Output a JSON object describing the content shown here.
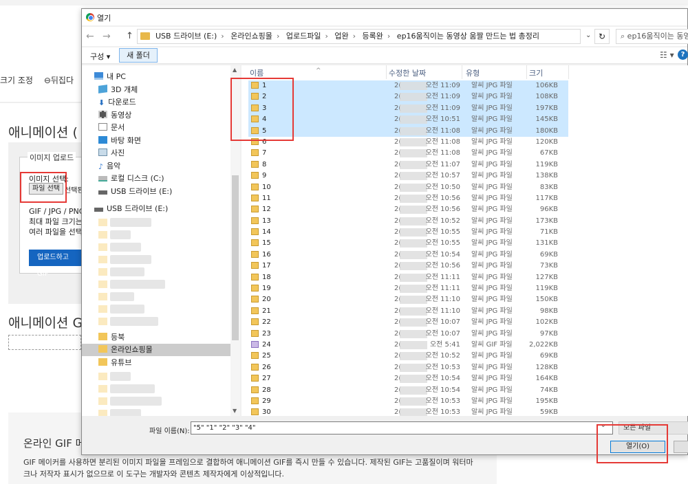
{
  "background": {
    "toolbar_items": [
      "크기 조정",
      "⊖뒤집다"
    ],
    "heading": "애니메이션 GIF",
    "heading_partial": "애니메이션 (",
    "fieldset_legend": "이미지 업로드",
    "image_select_label": "이미지 선택:",
    "file_button": "파일 선택",
    "no_file_text": "선택된",
    "notes": [
      "GIF / JPG / PNG",
      "최대 파일 크기는",
      "여러 파일을 선택"
    ],
    "upload_button": "업로드하고 GIF",
    "heading2": "애니메이션 GIF",
    "section_title": "온라인 GIF 메",
    "paragraph_line1": "GIF 메이커를 사용하면 분리된 이미지 파일을 프레임으로 결합하여 애니메이션 GIF를 즉시 만들 수 있습니다. 제작된 GIF는 고품질이며 워터마",
    "paragraph_line2": "크나 저작자 표시가 없으므로 이 도구는 개발자와 콘텐츠 제작자에게 이상적입니다."
  },
  "dialog": {
    "title": "열기",
    "nav": {
      "back": "←",
      "forward": "→",
      "up": "↑"
    },
    "breadcrumbs": [
      "USB 드라이브 (E:)",
      "온라인쇼핑몰",
      "업로드파일",
      "업완",
      "등록완",
      "ep16움직이는 동영상 움짤 만드는 법 총정리"
    ],
    "search_placeholder": "ep16움직이는 동영",
    "organize": "구성 ▾",
    "new_folder": "새 폴더",
    "sidebar": [
      {
        "label": "내 PC",
        "icon": "pc-icon"
      },
      {
        "label": "3D 개체",
        "icon": "cube-icon"
      },
      {
        "label": "다운로드",
        "icon": "download-icon"
      },
      {
        "label": "동영상",
        "icon": "video-icon"
      },
      {
        "label": "문서",
        "icon": "document-icon"
      },
      {
        "label": "바탕 화면",
        "icon": "desktop-icon"
      },
      {
        "label": "사진",
        "icon": "picture-icon"
      },
      {
        "label": "음악",
        "icon": "music-icon"
      },
      {
        "label": "로컬 디스크 (C:)",
        "icon": "drive-icon"
      },
      {
        "label": "USB 드라이브 (E:)",
        "icon": "usb-icon"
      },
      {
        "label": "USB 드라이브 (E:)",
        "icon": "usb-icon"
      }
    ],
    "sidebar_lower": {
      "folder_1": "온라인쇼핑몰",
      "folder_2": "유튜브",
      "folder_partial": "등북"
    },
    "columns": {
      "name": "이름",
      "date": "수정한 날짜",
      "type": "유형",
      "size": "크기"
    },
    "files": [
      {
        "name": "1",
        "time": "오전 11:09",
        "type": "알씨 JPG 파일",
        "size": "106KB",
        "selected": true
      },
      {
        "name": "2",
        "time": "오전 11:09",
        "type": "알씨 JPG 파일",
        "size": "108KB",
        "selected": true
      },
      {
        "name": "3",
        "time": "오전 11:09",
        "type": "알씨 JPG 파일",
        "size": "197KB",
        "selected": true
      },
      {
        "name": "4",
        "time": "오전 10:51",
        "type": "알씨 JPG 파일",
        "size": "145KB",
        "selected": true
      },
      {
        "name": "5",
        "time": "오전 11:08",
        "type": "알씨 JPG 파일",
        "size": "180KB",
        "selected": true
      },
      {
        "name": "6",
        "time": "오전 11:08",
        "type": "알씨 JPG 파일",
        "size": "120KB",
        "selected": false
      },
      {
        "name": "7",
        "time": "오전 11:08",
        "type": "알씨 JPG 파일",
        "size": "67KB",
        "selected": false
      },
      {
        "name": "8",
        "time": "오전 11:07",
        "type": "알씨 JPG 파일",
        "size": "119KB",
        "selected": false
      },
      {
        "name": "9",
        "time": "오전 10:57",
        "type": "알씨 JPG 파일",
        "size": "138KB",
        "selected": false
      },
      {
        "name": "10",
        "time": "오전 10:50",
        "type": "알씨 JPG 파일",
        "size": "83KB",
        "selected": false
      },
      {
        "name": "11",
        "time": "오전 10:56",
        "type": "알씨 JPG 파일",
        "size": "117KB",
        "selected": false
      },
      {
        "name": "12",
        "time": "오전 10:56",
        "type": "알씨 JPG 파일",
        "size": "96KB",
        "selected": false
      },
      {
        "name": "13",
        "time": "오전 10:52",
        "type": "알씨 JPG 파일",
        "size": "173KB",
        "selected": false
      },
      {
        "name": "14",
        "time": "오전 10:55",
        "type": "알씨 JPG 파일",
        "size": "71KB",
        "selected": false
      },
      {
        "name": "15",
        "time": "오전 10:55",
        "type": "알씨 JPG 파일",
        "size": "131KB",
        "selected": false
      },
      {
        "name": "16",
        "time": "오전 10:54",
        "type": "알씨 JPG 파일",
        "size": "69KB",
        "selected": false
      },
      {
        "name": "17",
        "time": "오전 10:56",
        "type": "알씨 JPG 파일",
        "size": "73KB",
        "selected": false
      },
      {
        "name": "18",
        "time": "오전 11:11",
        "type": "알씨 JPG 파일",
        "size": "127KB",
        "selected": false
      },
      {
        "name": "19",
        "time": "오전 11:11",
        "type": "알씨 JPG 파일",
        "size": "119KB",
        "selected": false
      },
      {
        "name": "20",
        "time": "오전 11:10",
        "type": "알씨 JPG 파일",
        "size": "150KB",
        "selected": false
      },
      {
        "name": "21",
        "time": "오전 11:10",
        "type": "알씨 JPG 파일",
        "size": "98KB",
        "selected": false
      },
      {
        "name": "22",
        "time": "오전 10:07",
        "type": "알씨 JPG 파일",
        "size": "102KB",
        "selected": false
      },
      {
        "name": "23",
        "time": "오전 10:07",
        "type": "알씨 JPG 파일",
        "size": "97KB",
        "selected": false
      },
      {
        "name": "24",
        "time": "오전 5:41",
        "type": "알씨 GIF 파일",
        "size": "2,022KB",
        "selected": false,
        "gif": true
      },
      {
        "name": "25",
        "time": "오전 10:52",
        "type": "알씨 JPG 파일",
        "size": "69KB",
        "selected": false
      },
      {
        "name": "26",
        "time": "오전 10:53",
        "type": "알씨 JPG 파일",
        "size": "128KB",
        "selected": false
      },
      {
        "name": "27",
        "time": "오전 10:54",
        "type": "알씨 JPG 파일",
        "size": "164KB",
        "selected": false
      },
      {
        "name": "28",
        "time": "오전 10:54",
        "type": "알씨 JPG 파일",
        "size": "74KB",
        "selected": false
      },
      {
        "name": "29",
        "time": "오전 10:53",
        "type": "알씨 JPG 파일",
        "size": "195KB",
        "selected": false
      },
      {
        "name": "30",
        "time": "오전 10:53",
        "type": "알씨 JPG 파일",
        "size": "59KB",
        "selected": false
      }
    ],
    "date_prefix": "2(",
    "filename_label": "파일 이름(N):",
    "filename_value": "\"5\" \"1\" \"2\" \"3\" \"4\"",
    "filetype_value": "모든 파일",
    "open_button": "열기(O)",
    "highlight_color": "#e53935",
    "selection_color": "#cce8ff"
  }
}
